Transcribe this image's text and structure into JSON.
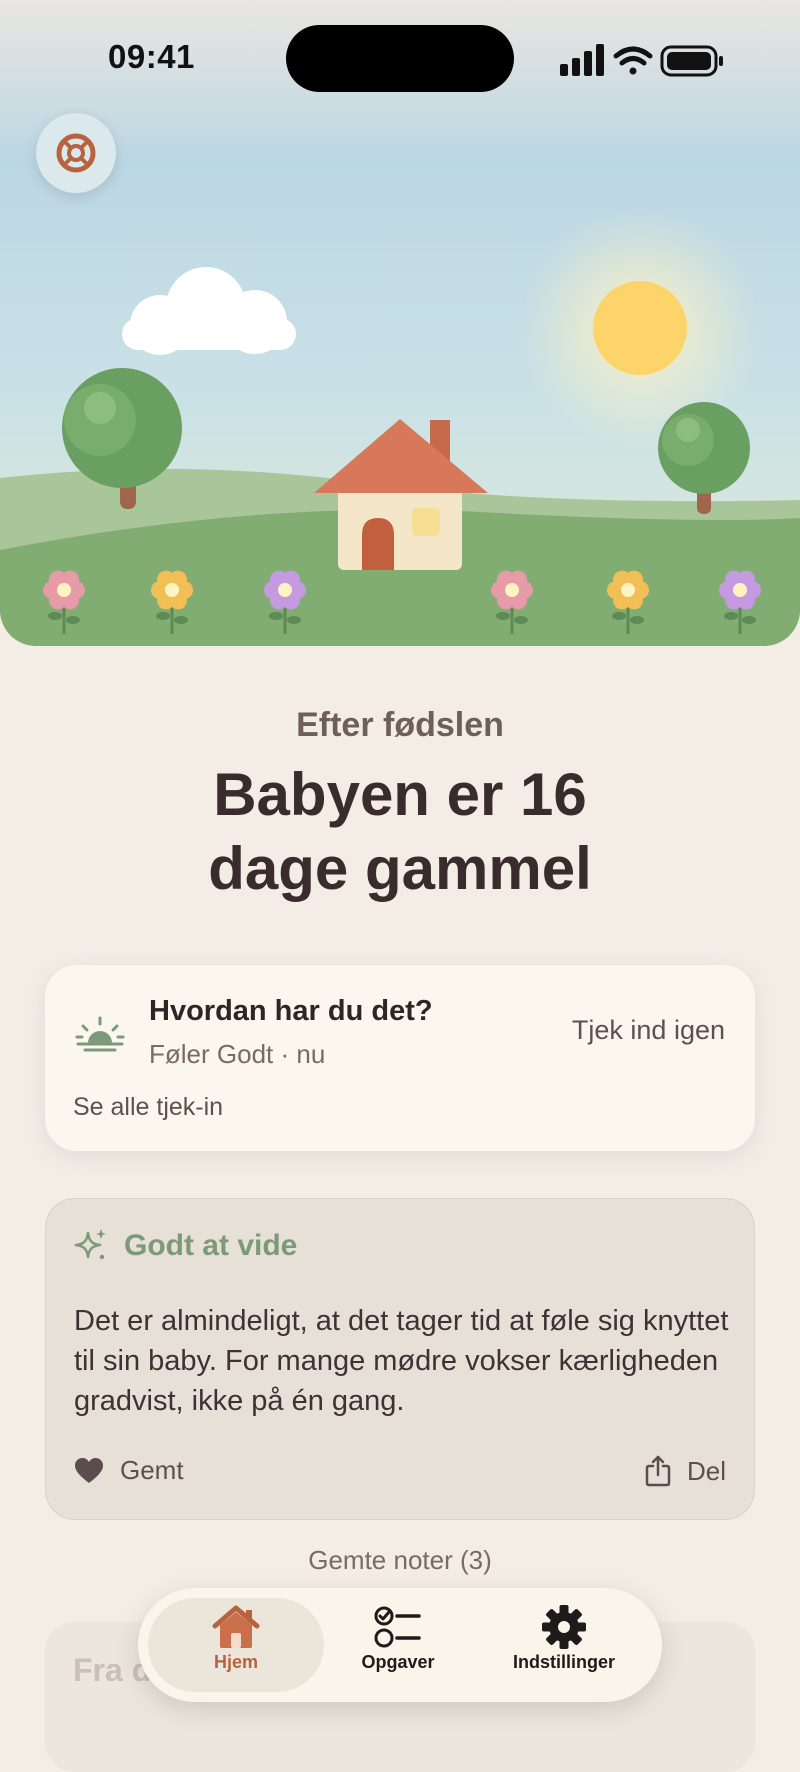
{
  "status_bar": {
    "time": "09:41"
  },
  "hero": {
    "help_button": "lifebuoy-icon"
  },
  "header": {
    "subtitle": "Efter fødslen",
    "title_line1": "Babyen er 16",
    "title_line2": "dage gammel"
  },
  "checkin": {
    "icon": "sunrise-icon",
    "title": "Hvordan har du det?",
    "status": "Føler Godt · nu",
    "action": "Tjek ind igen",
    "link": "Se alle tjek-in"
  },
  "info_card": {
    "icon": "sparkle-icon",
    "title": "Godt at vide",
    "body": "Det er almindeligt, at det tager tid at føle sig knyttet til sin baby. For mange mødre vokser kærligheden gradvist, ikke på én gang.",
    "saved_label": "Gemt",
    "share_label": "Del"
  },
  "saved_notes": "Gemte noter (3)",
  "next_card": {
    "title": "Fra din jordemoder"
  },
  "tabbar": {
    "tabs": [
      {
        "label": "Hjem",
        "icon": "home-icon",
        "active": true
      },
      {
        "label": "Opgaver",
        "icon": "checklist-icon",
        "active": false
      },
      {
        "label": "Indstillinger",
        "icon": "gear-icon",
        "active": false
      }
    ]
  },
  "colors": {
    "accent": "#b9623f",
    "sage": "#7d9a78",
    "background": "#f3ede6"
  }
}
